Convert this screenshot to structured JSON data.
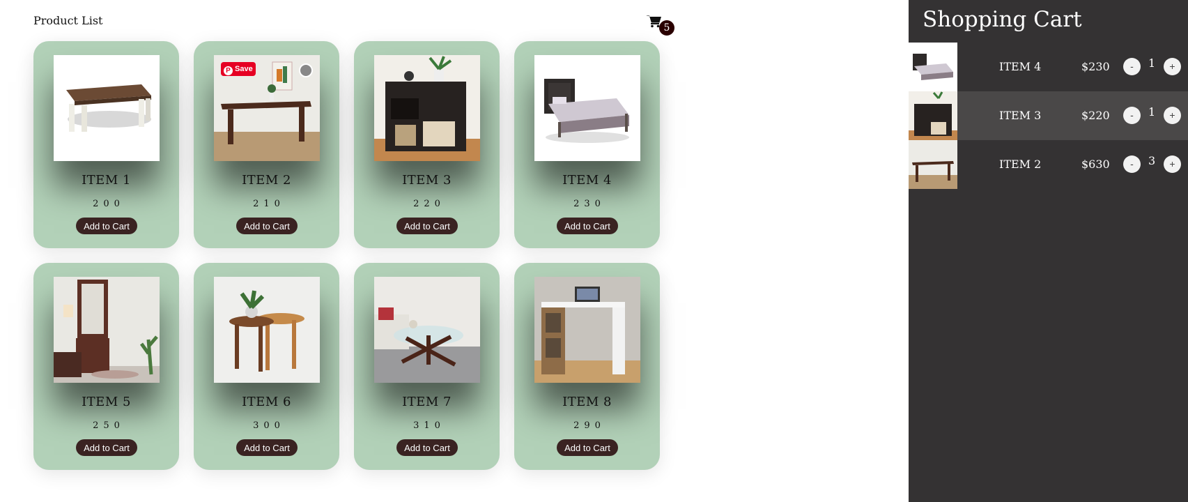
{
  "product_list": {
    "title": "Product List",
    "cart_icon": "cart-icon",
    "cart_count": "5",
    "add_label": "Add to Cart",
    "items": [
      {
        "name": "ITEM 1",
        "price": "200"
      },
      {
        "name": "ITEM 2",
        "price": "210"
      },
      {
        "name": "ITEM 3",
        "price": "220"
      },
      {
        "name": "ITEM 4",
        "price": "230"
      },
      {
        "name": "ITEM 5",
        "price": "250"
      },
      {
        "name": "ITEM 6",
        "price": "300"
      },
      {
        "name": "ITEM 7",
        "price": "310"
      },
      {
        "name": "ITEM 8",
        "price": "290"
      }
    ],
    "pinterest_save": "Save",
    "colors": {
      "card": "#b2d1b8",
      "button": "#3a2322",
      "badge": "#2a0000"
    }
  },
  "cart": {
    "title": "Shopping Cart",
    "minus_label": "-",
    "plus_label": "+",
    "rows": [
      {
        "name": "ITEM 4",
        "price": "$230",
        "qty": "1"
      },
      {
        "name": "ITEM 3",
        "price": "$220",
        "qty": "1"
      },
      {
        "name": "ITEM 2",
        "price": "$630",
        "qty": "3"
      }
    ],
    "colors": {
      "panel": "#343233",
      "highlight_row": "#4a4848"
    }
  }
}
